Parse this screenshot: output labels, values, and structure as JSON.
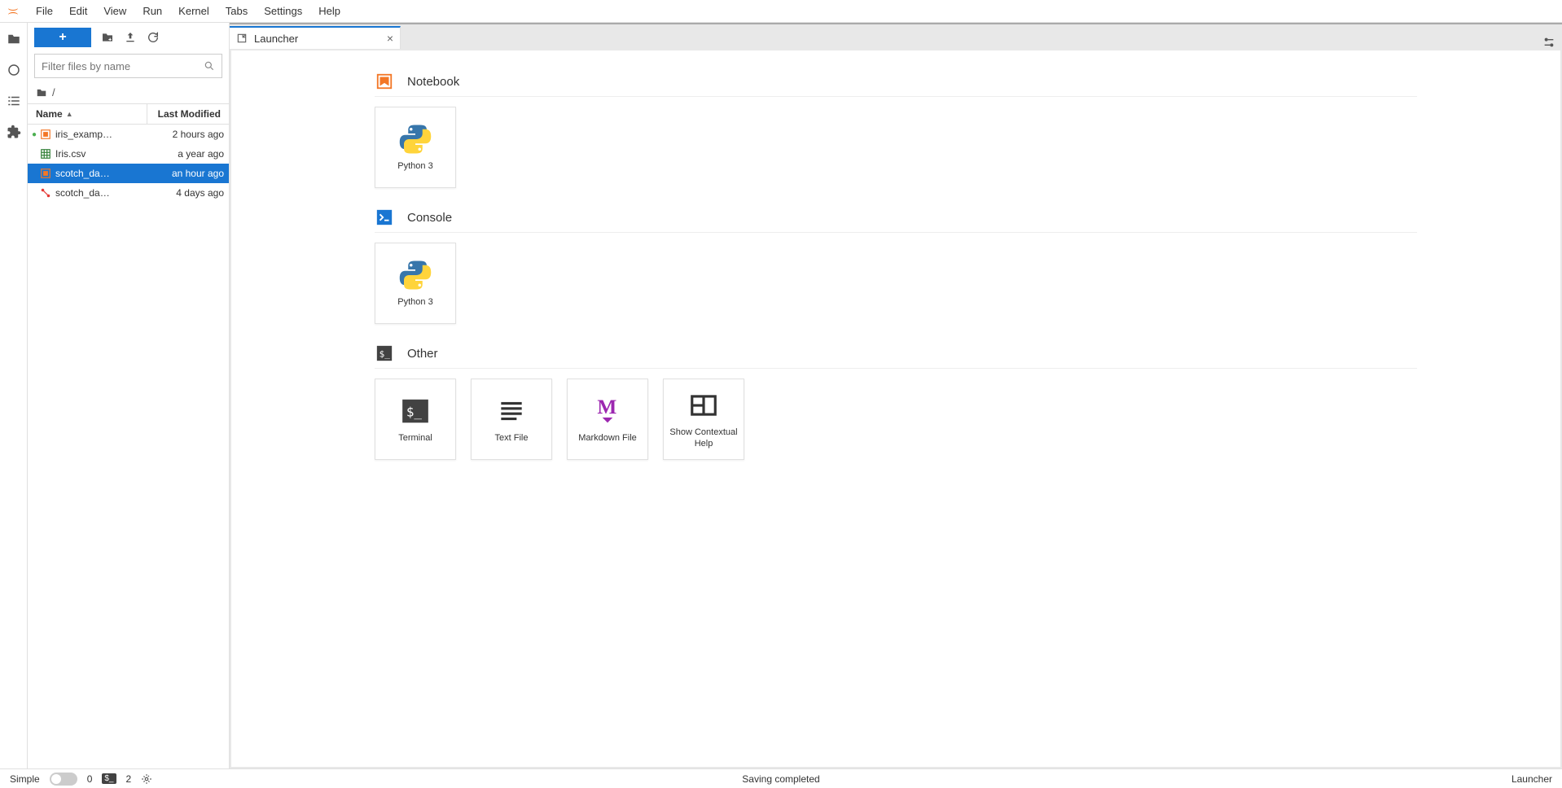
{
  "menus": [
    "File",
    "Edit",
    "View",
    "Run",
    "Kernel",
    "Tabs",
    "Settings",
    "Help"
  ],
  "filter_placeholder": "Filter files by name",
  "breadcrumb_path": "/",
  "file_header": {
    "name": "Name",
    "modified": "Last Modified"
  },
  "files": [
    {
      "name": "iris_examp…",
      "modified": "2 hours ago",
      "icon": "notebook",
      "running": true,
      "selected": false
    },
    {
      "name": "Iris.csv",
      "modified": "a year ago",
      "icon": "csv",
      "running": false,
      "selected": false
    },
    {
      "name": "scotch_da…",
      "modified": "an hour ago",
      "icon": "notebook",
      "running": false,
      "selected": true
    },
    {
      "name": "scotch_da…",
      "modified": "4 days ago",
      "icon": "git",
      "running": false,
      "selected": false
    }
  ],
  "tab": {
    "title": "Launcher"
  },
  "sections": [
    {
      "title": "Notebook",
      "icon": "notebook-section",
      "tiles": [
        {
          "label": "Python 3",
          "icon": "python"
        }
      ]
    },
    {
      "title": "Console",
      "icon": "console-section",
      "tiles": [
        {
          "label": "Python 3",
          "icon": "python"
        }
      ]
    },
    {
      "title": "Other",
      "icon": "terminal-section",
      "tiles": [
        {
          "label": "Terminal",
          "icon": "terminal"
        },
        {
          "label": "Text File",
          "icon": "textfile"
        },
        {
          "label": "Markdown File",
          "icon": "markdown"
        },
        {
          "label": "Show Contextual Help",
          "icon": "contexthelp"
        }
      ]
    }
  ],
  "statusbar": {
    "simple_label": "Simple",
    "kernel_count": "0",
    "terminal_count": "2",
    "saving_msg": "Saving completed",
    "mode": "Launcher"
  }
}
